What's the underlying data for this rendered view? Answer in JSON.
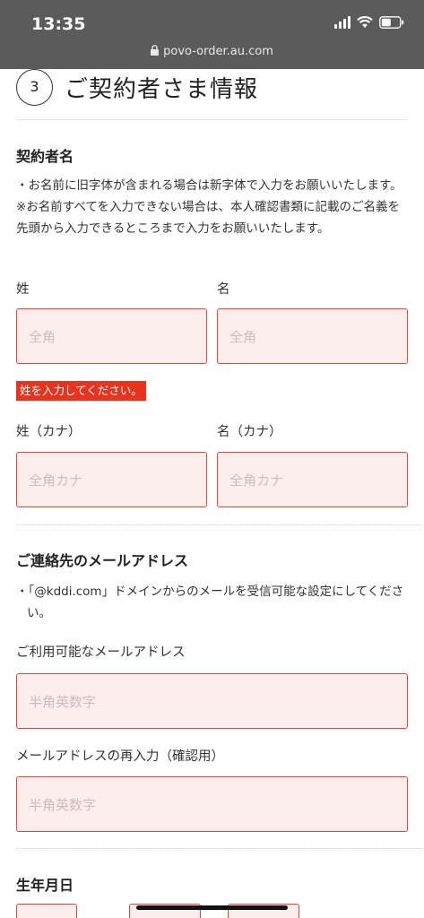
{
  "status_bar": {
    "time": "13:35"
  },
  "browser": {
    "url": "povo-order.au.com"
  },
  "step": {
    "number": "3",
    "title": "ご契約者さま情報"
  },
  "contract_name": {
    "heading": "契約者名",
    "notes": [
      "・お名前に旧字体が含まれる場合は新字体で入力をお願いいたします。",
      "※お名前すべてを入力できない場合は、本人確認書類に記載のご名義を先頭から入力できるところまで入力をお願いいたします。"
    ],
    "last_name": {
      "label": "姓",
      "placeholder": "全角"
    },
    "first_name": {
      "label": "名",
      "placeholder": "全角"
    },
    "error": "姓を入力してください。",
    "last_name_kana": {
      "label": "姓（カナ）",
      "placeholder": "全角カナ"
    },
    "first_name_kana": {
      "label": "名（カナ）",
      "placeholder": "全角カナ"
    }
  },
  "contact_email": {
    "heading": "ご連絡先のメールアドレス",
    "note": "・「@kddi.com」ドメインからのメールを受信可能な設定にしてください。",
    "email": {
      "label": "ご利用可能なメールアドレス",
      "placeholder": "半角英数字"
    },
    "email_confirm": {
      "label": "メールアドレスの再入力（確認用）",
      "placeholder": "半角英数字"
    }
  },
  "birthdate": {
    "heading": "生年月日"
  },
  "colors": {
    "error_border": "#e0463c",
    "input_bg": "#fdeeee",
    "error_badge": "#e8331f",
    "chrome": "#5b5b5b"
  }
}
